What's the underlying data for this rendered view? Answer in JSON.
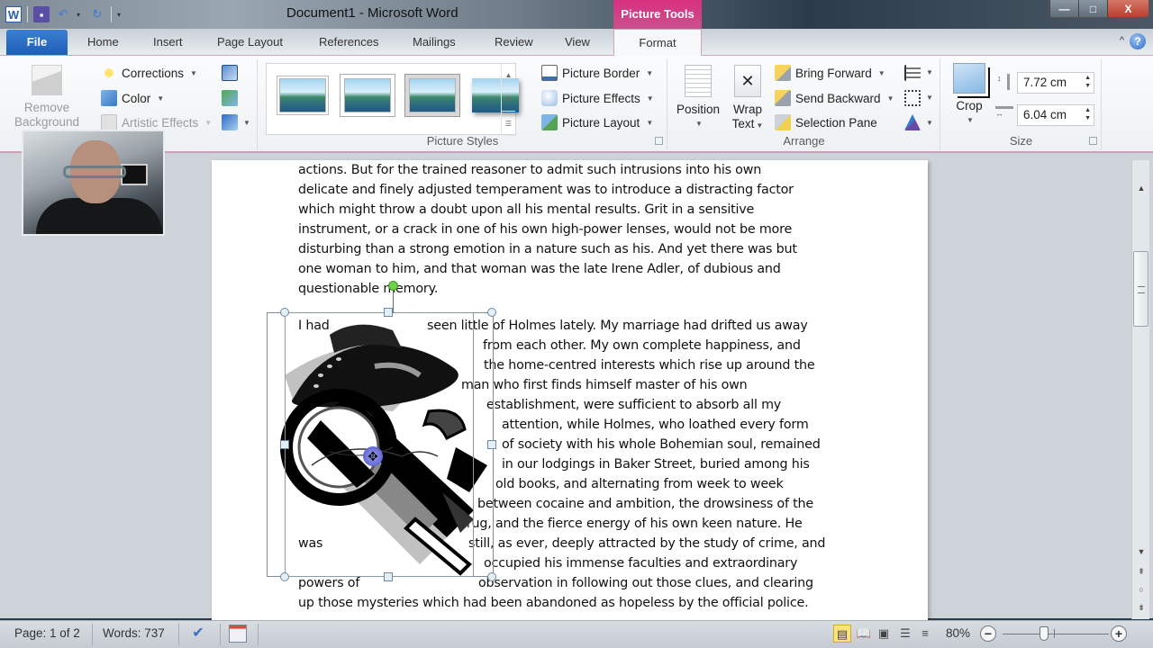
{
  "app": {
    "document_title": "Document1 - Microsoft Word",
    "contextual_tab_group": "Picture Tools",
    "accent_color": "#c9508d",
    "file_tab_color": "#2a6bc6"
  },
  "quick_access": {
    "icons": [
      "word-logo-icon",
      "save-icon",
      "undo-icon",
      "redo-icon",
      "customize-qat-icon"
    ],
    "word_logo_glyph": "W",
    "undo_glyph": "↶",
    "redo_glyph": "↻",
    "save_glyph": "▪",
    "dropdown_glyph": "▾",
    "customize_glyph": "▾"
  },
  "window_controls": {
    "minimize": "—",
    "maximize": "□",
    "close": "X"
  },
  "tabs": {
    "file": "File",
    "items": [
      "Home",
      "Insert",
      "Page Layout",
      "References",
      "Mailings",
      "Review",
      "View"
    ],
    "active": "Format",
    "minimize_ribbon_glyph": "^",
    "help_glyph": "?"
  },
  "ribbon": {
    "adjust": {
      "remove_background_line1": "Remove",
      "remove_background_line2": "Background",
      "corrections": "Corrections",
      "color": "Color",
      "artistic_effects": "Artistic Effects",
      "small_icons": [
        "compress-pictures-icon",
        "change-picture-icon",
        "reset-picture-icon"
      ]
    },
    "picture_styles": {
      "group_label": "Picture Styles",
      "gallery_count": 4,
      "picture_border": "Picture Border",
      "picture_effects": "Picture Effects",
      "picture_layout": "Picture Layout"
    },
    "arrange": {
      "group_label": "Arrange",
      "position": "Position",
      "wrap_text_line1": "Wrap",
      "wrap_text_line2": "Text",
      "bring_forward": "Bring Forward",
      "send_backward": "Send Backward",
      "selection_pane": "Selection Pane",
      "small_icons": [
        "align-icon",
        "group-icon",
        "rotate-icon"
      ]
    },
    "size": {
      "group_label": "Size",
      "crop": "Crop",
      "height_value": "7.72 cm",
      "width_value": "6.04 cm"
    }
  },
  "document": {
    "lines_top": [
      "actions. But for the trained reasoner to admit such intrusions  into his own",
      "delicate and finely adjusted temperament  was to introduce  a distracting factor",
      "which might throw a doubt  upon all his mental results. Grit in a sensitive",
      "instrument, or a crack in one of his own high-power  lenses, would not be more",
      "disturbing  than a strong emotion  in a nature such as his. And yet there was but",
      "one woman to him, and that woman was the late Irene Adler, of dubious  and",
      "questionable memory."
    ],
    "wrapped_lines": [
      {
        "left": "I had",
        "right": "seen little of Holmes lately. My marriage had drifted  us away"
      },
      {
        "left": "",
        "right": "from each other. My own complete  happiness, and"
      },
      {
        "left": "",
        "right": "the home-centred  interests which rise up around the"
      },
      {
        "left": "",
        "right": "man who first finds himself  master of his own"
      },
      {
        "left": "",
        "right": "establishment, were sufficient  to absorb all my"
      },
      {
        "left": "",
        "right": "attention, while Holmes, who loathed every form"
      },
      {
        "left": "",
        "right": "of society with his whole Bohemian  soul, remained"
      },
      {
        "left": "",
        "right": "in our lodgings in Baker Street, buried  among  his"
      },
      {
        "left": "",
        "right": "old books, and alternating from week to week"
      },
      {
        "left": "",
        "right": "between cocaine and ambition, the drowsiness of the"
      },
      {
        "left": "",
        "right": "drug, and the fierce energy of his own keen nature. He"
      },
      {
        "left": "was",
        "right": "still, as ever, deeply attracted by the study of crime, and"
      },
      {
        "left": "",
        "right": "occupied his immense faculties and extraordinary"
      },
      {
        "left": "powers of",
        "right": "observation in following  out those clues, and clearing"
      }
    ],
    "lines_bottom": [
      "up those mysteries which had been abandoned  as hopeless by the official  police."
    ],
    "picture_description": "Sherlock Holmes clip art: deerstalker hat, magnifying glass, pipe"
  },
  "statusbar": {
    "page": "Page: 1 of 2",
    "words": "Words: 737",
    "zoom_level": "80%",
    "zoom_percent": 80,
    "views": [
      "print-layout",
      "full-screen-reading",
      "web-layout",
      "outline",
      "draft"
    ],
    "active_view": "print-layout",
    "zoom_out_glyph": "−",
    "zoom_in_glyph": "+"
  },
  "scrollbar": {
    "up_glyph": "▲",
    "down_glyph": "▼",
    "prev_page_glyph": "⇞",
    "browse_glyph": "○",
    "next_page_glyph": "⇟",
    "position_fraction": 0.2
  }
}
